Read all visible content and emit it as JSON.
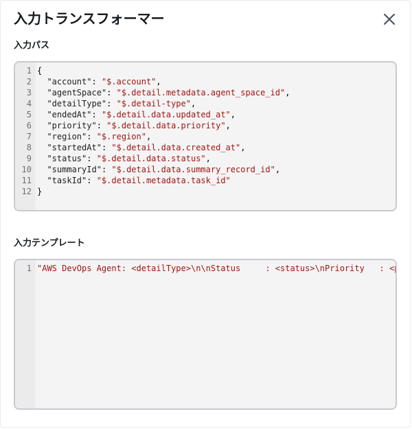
{
  "modal": {
    "title": "入力トランスフォーマー"
  },
  "input_path": {
    "label": "入力パス",
    "lines": [
      {
        "num": "1",
        "parts": [
          {
            "t": "punc",
            "v": "{"
          }
        ]
      },
      {
        "num": "2",
        "parts": [
          {
            "t": "punc",
            "v": "  "
          },
          {
            "t": "key",
            "v": "\"account\""
          },
          {
            "t": "punc",
            "v": ": "
          },
          {
            "t": "str",
            "v": "\"$.account\""
          },
          {
            "t": "punc",
            "v": ","
          }
        ]
      },
      {
        "num": "3",
        "parts": [
          {
            "t": "punc",
            "v": "  "
          },
          {
            "t": "key",
            "v": "\"agentSpace\""
          },
          {
            "t": "punc",
            "v": ": "
          },
          {
            "t": "str",
            "v": "\"$.detail.metadata.agent_space_id\""
          },
          {
            "t": "punc",
            "v": ","
          }
        ]
      },
      {
        "num": "4",
        "parts": [
          {
            "t": "punc",
            "v": "  "
          },
          {
            "t": "key",
            "v": "\"detailType\""
          },
          {
            "t": "punc",
            "v": ": "
          },
          {
            "t": "str",
            "v": "\"$.detail-type\""
          },
          {
            "t": "punc",
            "v": ","
          }
        ]
      },
      {
        "num": "5",
        "parts": [
          {
            "t": "punc",
            "v": "  "
          },
          {
            "t": "key",
            "v": "\"endedAt\""
          },
          {
            "t": "punc",
            "v": ": "
          },
          {
            "t": "str",
            "v": "\"$.detail.data.updated_at\""
          },
          {
            "t": "punc",
            "v": ","
          }
        ]
      },
      {
        "num": "6",
        "parts": [
          {
            "t": "punc",
            "v": "  "
          },
          {
            "t": "key",
            "v": "\"priority\""
          },
          {
            "t": "punc",
            "v": ": "
          },
          {
            "t": "str",
            "v": "\"$.detail.data.priority\""
          },
          {
            "t": "punc",
            "v": ","
          }
        ]
      },
      {
        "num": "7",
        "parts": [
          {
            "t": "punc",
            "v": "  "
          },
          {
            "t": "key",
            "v": "\"region\""
          },
          {
            "t": "punc",
            "v": ": "
          },
          {
            "t": "str",
            "v": "\"$.region\""
          },
          {
            "t": "punc",
            "v": ","
          }
        ]
      },
      {
        "num": "8",
        "parts": [
          {
            "t": "punc",
            "v": "  "
          },
          {
            "t": "key",
            "v": "\"startedAt\""
          },
          {
            "t": "punc",
            "v": ": "
          },
          {
            "t": "str",
            "v": "\"$.detail.data.created_at\""
          },
          {
            "t": "punc",
            "v": ","
          }
        ]
      },
      {
        "num": "9",
        "parts": [
          {
            "t": "punc",
            "v": "  "
          },
          {
            "t": "key",
            "v": "\"status\""
          },
          {
            "t": "punc",
            "v": ": "
          },
          {
            "t": "str",
            "v": "\"$.detail.data.status\""
          },
          {
            "t": "punc",
            "v": ","
          }
        ]
      },
      {
        "num": "10",
        "parts": [
          {
            "t": "punc",
            "v": "  "
          },
          {
            "t": "key",
            "v": "\"summaryId\""
          },
          {
            "t": "punc",
            "v": ": "
          },
          {
            "t": "str",
            "v": "\"$.detail.data.summary_record_id\""
          },
          {
            "t": "punc",
            "v": ","
          }
        ]
      },
      {
        "num": "11",
        "parts": [
          {
            "t": "punc",
            "v": "  "
          },
          {
            "t": "key",
            "v": "\"taskId\""
          },
          {
            "t": "punc",
            "v": ": "
          },
          {
            "t": "str",
            "v": "\"$.detail.metadata.task_id\""
          }
        ]
      },
      {
        "num": "12",
        "parts": [
          {
            "t": "punc",
            "v": "}"
          }
        ]
      }
    ]
  },
  "input_template": {
    "label": "入力テンプレート",
    "lines": [
      {
        "num": "1",
        "parts": [
          {
            "t": "str",
            "v": "\"AWS DevOps Agent: <detailType>\\n\\nStatus     : <status>\\nPriority   : <p"
          }
        ]
      }
    ]
  },
  "icons": {
    "close": "close-icon"
  }
}
